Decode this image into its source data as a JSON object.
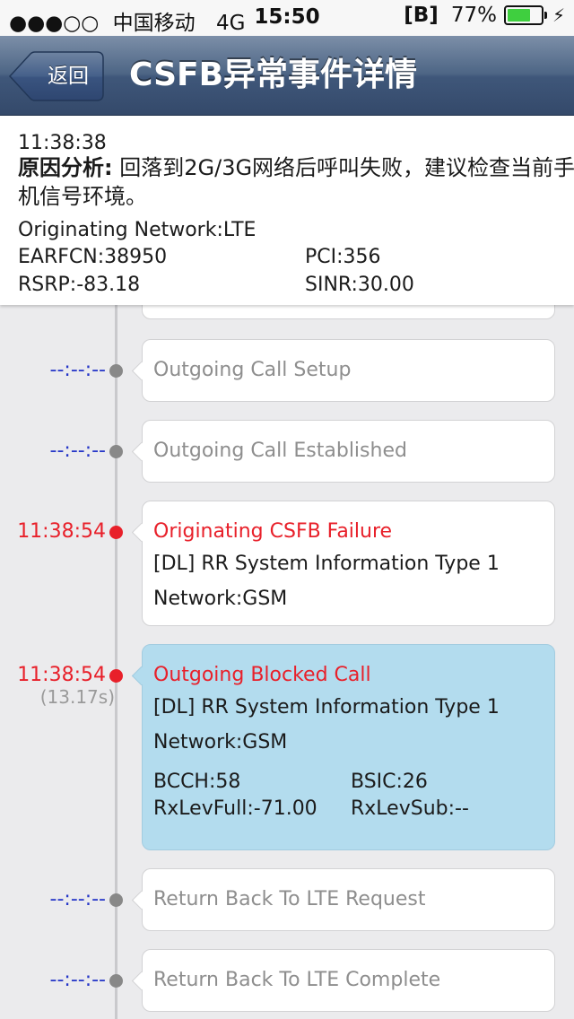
{
  "status_bar": {
    "signal": "●●●○○",
    "carrier": "中国移动",
    "network": "4G",
    "time": "15:50",
    "b_icon": "[B]",
    "battery_text": "77%",
    "battery_level": 0.77,
    "charging_icon": "⚡"
  },
  "nav": {
    "back_label": "返回",
    "title": "CSFB异常事件详情"
  },
  "summary": {
    "time": "11:38:38",
    "cause_label": "原因分析:",
    "cause_text": " 回落到2G/3G网络后呼叫失败，建议检查当前手机信号环境。",
    "originating_network": "Originating Network:LTE",
    "earfcn": "EARFCN:38950",
    "pci": "PCI:356",
    "rsrp": "RSRP:-83.18",
    "sinr": "SINR:30.00"
  },
  "colors": {
    "time_placeholder": "#2536c8",
    "error_red": "#e8202a",
    "dot_gray": "#888888",
    "highlight_bg": "#b3dcee",
    "muted_text": "#8e8e8e"
  },
  "timeline": {
    "events": [
      {
        "time": "--:--:--",
        "status": "pending",
        "title": "Outgoing Call Setup"
      },
      {
        "time": "--:--:--",
        "status": "pending",
        "title": "Outgoing Call Established"
      },
      {
        "time": "11:38:54",
        "status": "error",
        "title": "Originating CSFB Failure",
        "detail": "[DL] RR System Information Type 1",
        "network": "Network:GSM"
      },
      {
        "time": "11:38:54",
        "duration": "(13.17s)",
        "status": "error",
        "highlight": true,
        "title": "Outgoing Blocked Call",
        "detail": "[DL] RR System Information Type 1",
        "network": "Network:GSM",
        "bcch": "BCCH:58",
        "bsic": "BSIC:26",
        "rxlev_full": "RxLevFull:-71.00",
        "rxlev_sub": "RxLevSub:--"
      },
      {
        "time": "--:--:--",
        "status": "pending",
        "title": "Return Back To LTE Request"
      },
      {
        "time": "--:--:--",
        "status": "pending",
        "title": "Return Back To LTE Complete"
      }
    ]
  }
}
